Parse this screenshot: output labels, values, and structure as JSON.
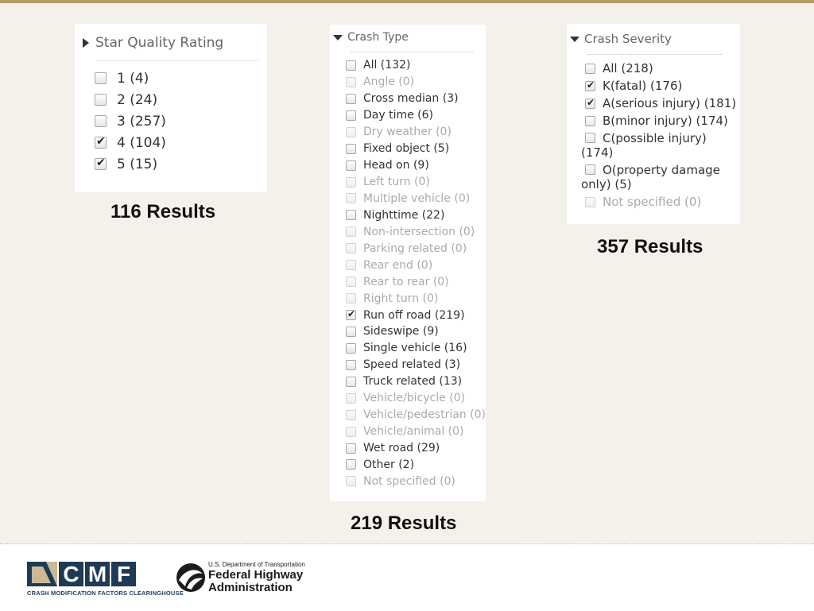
{
  "star_panel": {
    "header": "Star Quality Rating",
    "options": [
      {
        "label": "1 (4)",
        "checked": false,
        "disabled": false
      },
      {
        "label": "2 (24)",
        "checked": false,
        "disabled": false
      },
      {
        "label": "3 (257)",
        "checked": false,
        "disabled": false
      },
      {
        "label": "4 (104)",
        "checked": true,
        "disabled": false
      },
      {
        "label": "5 (15)",
        "checked": true,
        "disabled": false
      }
    ],
    "results": "116 Results"
  },
  "crash_type_panel": {
    "header": "Crash Type",
    "options": [
      {
        "label": "All (132)",
        "checked": false,
        "disabled": false
      },
      {
        "label": "Angle (0)",
        "checked": false,
        "disabled": true
      },
      {
        "label": "Cross median (3)",
        "checked": false,
        "disabled": false
      },
      {
        "label": "Day time (6)",
        "checked": false,
        "disabled": false
      },
      {
        "label": "Dry weather (0)",
        "checked": false,
        "disabled": true
      },
      {
        "label": "Fixed object (5)",
        "checked": false,
        "disabled": false
      },
      {
        "label": "Head on (9)",
        "checked": false,
        "disabled": false
      },
      {
        "label": "Left turn (0)",
        "checked": false,
        "disabled": true
      },
      {
        "label": "Multiple vehicle (0)",
        "checked": false,
        "disabled": true
      },
      {
        "label": "Nighttime (22)",
        "checked": false,
        "disabled": false
      },
      {
        "label": "Non-intersection (0)",
        "checked": false,
        "disabled": true
      },
      {
        "label": "Parking related (0)",
        "checked": false,
        "disabled": true
      },
      {
        "label": "Rear end (0)",
        "checked": false,
        "disabled": true
      },
      {
        "label": "Rear to rear (0)",
        "checked": false,
        "disabled": true
      },
      {
        "label": "Right turn (0)",
        "checked": false,
        "disabled": true
      },
      {
        "label": "Run off road (219)",
        "checked": true,
        "disabled": false
      },
      {
        "label": "Sideswipe (9)",
        "checked": false,
        "disabled": false
      },
      {
        "label": "Single vehicle (16)",
        "checked": false,
        "disabled": false
      },
      {
        "label": "Speed related (3)",
        "checked": false,
        "disabled": false
      },
      {
        "label": "Truck related (13)",
        "checked": false,
        "disabled": false
      },
      {
        "label": "Vehicle/bicycle (0)",
        "checked": false,
        "disabled": true
      },
      {
        "label": "Vehicle/pedestrian (0)",
        "checked": false,
        "disabled": true
      },
      {
        "label": "Vehicle/animal (0)",
        "checked": false,
        "disabled": true
      },
      {
        "label": "Wet road (29)",
        "checked": false,
        "disabled": false
      },
      {
        "label": "Other (2)",
        "checked": false,
        "disabled": false
      },
      {
        "label": "Not specified (0)",
        "checked": false,
        "disabled": true
      }
    ],
    "results": "219 Results"
  },
  "crash_severity_panel": {
    "header": "Crash Severity",
    "options": [
      {
        "label": "All (218)",
        "checked": false,
        "disabled": false,
        "wrap": false
      },
      {
        "label": "K(fatal) (176)",
        "checked": true,
        "disabled": false,
        "wrap": false
      },
      {
        "label": "A(serious injury) (181)",
        "checked": true,
        "disabled": false,
        "wrap": false
      },
      {
        "label": "B(minor injury) (174)",
        "checked": false,
        "disabled": false,
        "wrap": false
      },
      {
        "label": "C(possible injury) (174)",
        "checked": false,
        "disabled": false,
        "wrap": true
      },
      {
        "label": "O(property damage only) (5)",
        "checked": false,
        "disabled": false,
        "wrap": true
      },
      {
        "label": "Not specified (0)",
        "checked": false,
        "disabled": true,
        "wrap": false
      }
    ],
    "results": "357 Results"
  },
  "footer": {
    "cmf_logo": {
      "letters": [
        "C",
        "M",
        "F"
      ],
      "tagline": "CRASH MODIFICATION FACTORS CLEARINGHOUSE"
    },
    "fhwa_logo": {
      "department": "U.S. Department of Transportation",
      "name_line1": "Federal Highway",
      "name_line2": "Administration"
    }
  }
}
